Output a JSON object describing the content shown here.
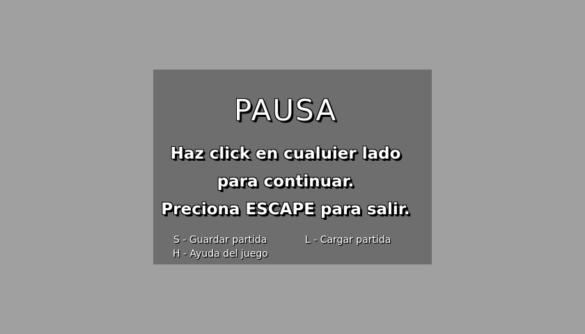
{
  "overlay": {
    "background_color": "#a0a0a0",
    "panel_color": "#6e6e6e"
  },
  "pause_menu": {
    "title": "PAUSA",
    "instructions": [
      "Haz click en cualuier lado",
      "para continuar.",
      "Preciona ESCAPE para salir."
    ],
    "shortcuts": {
      "save": "S - Guardar partida",
      "load": "L - Cargar partida",
      "help": "H - Ayuda del juego"
    }
  }
}
